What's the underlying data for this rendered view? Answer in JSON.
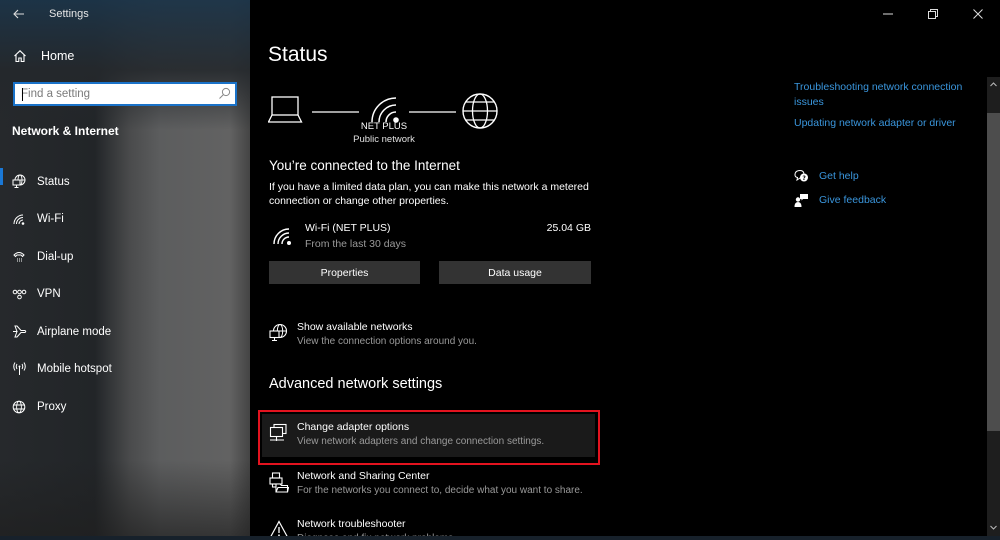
{
  "window": {
    "app_title": "Settings",
    "controls": {
      "minimize": "minimize-icon",
      "maximize": "restore-icon",
      "close": "close-icon"
    }
  },
  "sidebar": {
    "back_icon": "back-arrow-icon",
    "home": {
      "label": "Home",
      "icon": "home-icon"
    },
    "search": {
      "placeholder": "Find a setting",
      "value": "",
      "icon": "search-icon"
    },
    "section_title": "Network & Internet",
    "items": [
      {
        "label": "Status",
        "icon": "globe-monitor-icon",
        "active": true
      },
      {
        "label": "Wi-Fi",
        "icon": "wifi-icon",
        "active": false
      },
      {
        "label": "Dial-up",
        "icon": "phone-icon",
        "active": false
      },
      {
        "label": "VPN",
        "icon": "vpn-icon",
        "active": false
      },
      {
        "label": "Airplane mode",
        "icon": "airplane-icon",
        "active": false
      },
      {
        "label": "Mobile hotspot",
        "icon": "hotspot-icon",
        "active": false
      },
      {
        "label": "Proxy",
        "icon": "globe-icon",
        "active": false
      }
    ]
  },
  "main": {
    "title": "Status",
    "diagram": {
      "network_name": "NET PLUS",
      "network_type": "Public network"
    },
    "connection": {
      "heading": "You’re connected to the Internet",
      "description": "If you have a limited data plan, you can make this network a metered connection or change other properties.",
      "adapter_name": "Wi-Fi (NET PLUS)",
      "period": "From the last 30 days",
      "data_used": "25.04 GB"
    },
    "buttons": {
      "properties": "Properties",
      "data_usage": "Data usage"
    },
    "show_networks": {
      "title": "Show available networks",
      "subtitle": "View the connection options around you."
    },
    "advanced_heading": "Advanced network settings",
    "advanced_items": [
      {
        "title": "Change adapter options",
        "subtitle": "View network adapters and change connection settings.",
        "highlighted": true
      },
      {
        "title": "Network and Sharing Center",
        "subtitle": "For the networks you connect to, decide what you want to share."
      },
      {
        "title": "Network troubleshooter",
        "subtitle": "Diagnose and fix network problems"
      }
    ]
  },
  "rail": {
    "links": [
      "Troubleshooting network connection issues",
      "Updating network adapter or driver"
    ],
    "help": {
      "label": "Get help",
      "icon": "help-chat-icon"
    },
    "feedback": {
      "label": "Give feedback",
      "icon": "feedback-icon"
    }
  },
  "colors": {
    "accent": "#1a78d6",
    "link": "#3a96dd",
    "highlight_border": "#e3131f",
    "button_bg": "#333333"
  }
}
